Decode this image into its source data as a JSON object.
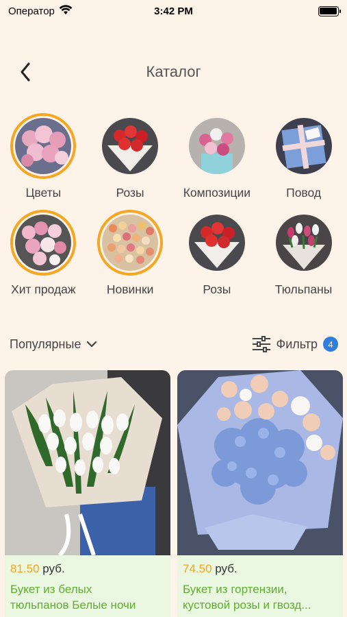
{
  "status_bar": {
    "carrier": "Оператор",
    "time": "3:42 PM"
  },
  "header": {
    "title": "Каталог"
  },
  "categories": [
    {
      "label": "Цветы",
      "active": true,
      "icon": "peonies-photo"
    },
    {
      "label": "Розы",
      "active": false,
      "icon": "red-roses-photo"
    },
    {
      "label": "Композиции",
      "active": false,
      "icon": "box-arrangement-photo"
    },
    {
      "label": "Повод",
      "active": false,
      "icon": "gift-box-photo"
    },
    {
      "label": "Хит продаж",
      "active": true,
      "icon": "peonies-bouquet-photo"
    },
    {
      "label": "Новинки",
      "active": true,
      "icon": "mixed-roses-photo"
    },
    {
      "label": "Розы",
      "active": false,
      "icon": "red-roses-photo"
    },
    {
      "label": "Тюльпаны",
      "active": false,
      "icon": "tulips-photo"
    }
  ],
  "sort": {
    "label": "Популярные"
  },
  "filter": {
    "label": "Фильтр",
    "count": "4"
  },
  "products": [
    {
      "price": "81.50",
      "currency": "руб.",
      "name_line1": "Букет из белых",
      "name_line2": "тюльпанов Белые ночи"
    },
    {
      "price": "74.50",
      "currency": "руб.",
      "name_line1": "Букет из гортензии,",
      "name_line2": "кустовой розы и гвозд..."
    }
  ],
  "colors": {
    "accent": "#f5a623",
    "background": "#fdf3e9",
    "product_name": "#5fae2e",
    "badge": "#2f7de1",
    "card_bg": "#eaf7e1"
  }
}
